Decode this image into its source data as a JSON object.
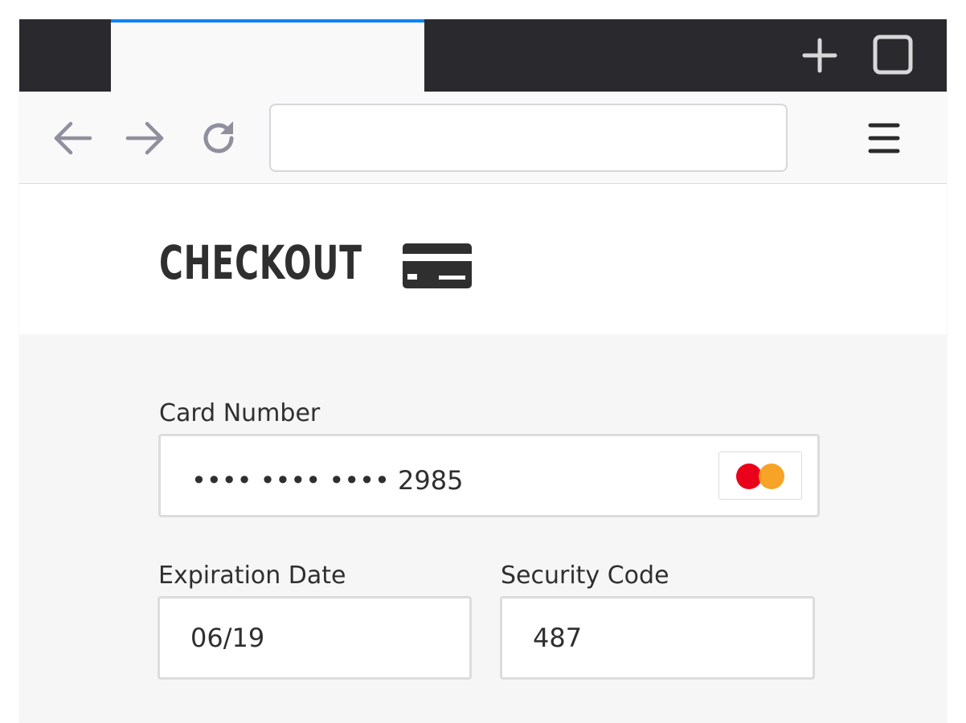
{
  "colors": {
    "tab_accent": "#0a84ff",
    "tabbar_bg": "#2a2a2e",
    "mastercard_red": "#eb001b",
    "mastercard_orange": "#f79e1b"
  },
  "tabbar": {
    "active_tab_label": "",
    "new_tab_icon": "plus-icon",
    "tabs_overview_icon": "square-icon"
  },
  "toolbar": {
    "back_icon": "arrow-left-icon",
    "forward_icon": "arrow-right-icon",
    "reload_icon": "reload-icon",
    "url_value": "",
    "menu_icon": "hamburger-menu-icon"
  },
  "page": {
    "title": "CHECKOUT",
    "title_icon": "credit-card-icon",
    "card_number": {
      "label": "Card Number",
      "value": "•••• •••• •••• 2985",
      "brand_icon": "mastercard-icon"
    },
    "expiration": {
      "label": "Expiration Date",
      "value": "06/19"
    },
    "security_code": {
      "label": "Security Code",
      "value": "487"
    }
  }
}
